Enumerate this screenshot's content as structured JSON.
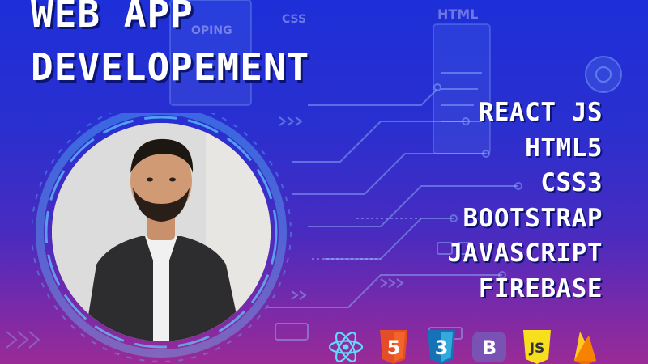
{
  "title": {
    "line1": "WEB APP",
    "line2": "DEVELOPEMENT"
  },
  "background_labels": {
    "ping": "OPING",
    "css": "CSS",
    "html": "HTML"
  },
  "skills": [
    "REACT JS",
    "HTML5",
    "CSS3",
    "BOOTSTRAP",
    "JAVASCRIPT",
    "FIREBASE"
  ],
  "tech_icons": [
    {
      "name": "react-icon",
      "glyph": ""
    },
    {
      "name": "html5-icon",
      "glyph": "5"
    },
    {
      "name": "css3-icon",
      "glyph": "3"
    },
    {
      "name": "bootstrap-icon",
      "glyph": "B"
    },
    {
      "name": "javascript-icon",
      "glyph": "JS"
    },
    {
      "name": "firebase-icon",
      "glyph": ""
    }
  ],
  "colors": {
    "bg_top": "#1d2fd8",
    "bg_bottom": "#9a2b96",
    "ring": "#5fd0ff",
    "html5": "#e44d26",
    "css3": "#1572b6",
    "bootstrap": "#7952b3",
    "javascript": "#f7df1e",
    "firebase": "#ffca28",
    "react": "#61dafb"
  }
}
